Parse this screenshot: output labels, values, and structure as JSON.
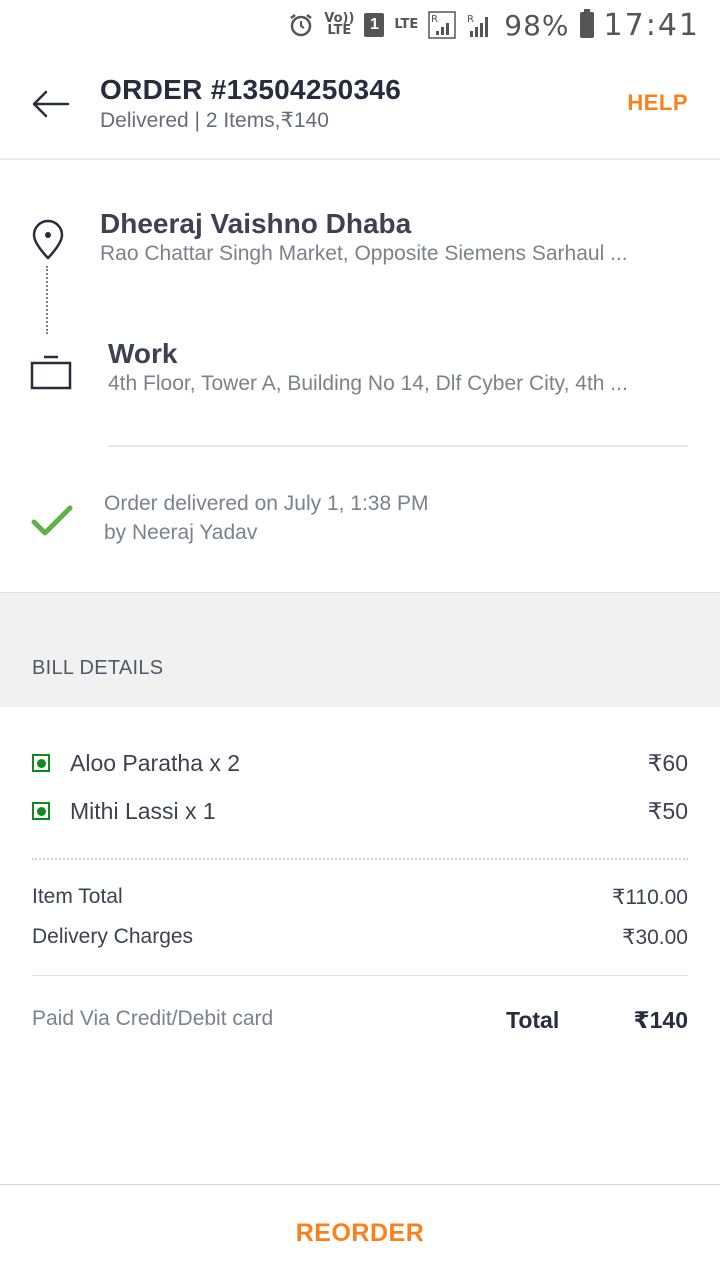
{
  "status_bar": {
    "volte_line1": "Vo))",
    "volte_line2": "LTE",
    "sim_slot": "1",
    "lte_label": "LTE",
    "roaming_1": "R",
    "roaming_2": "R",
    "battery_pct": "98%",
    "time": "17:41",
    "icons": [
      "alarm-icon",
      "signal-icon",
      "battery-icon"
    ]
  },
  "header": {
    "title": "ORDER #13504250346",
    "subtitle": "Delivered | 2 Items,₹140",
    "help_label": "HELP"
  },
  "restaurant": {
    "name": "Dheeraj Vaishno Dhaba",
    "address": "Rao Chattar Singh Market, Opposite Siemens Sarhaul ..."
  },
  "destination": {
    "title": "Work",
    "address": "4th Floor, Tower A, Building No 14, Dlf Cyber City, 4th ..."
  },
  "delivery": {
    "line1": "Order delivered on July 1, 1:38 PM",
    "line2": "by Neeraj Yadav"
  },
  "bill": {
    "title": "BILL DETAILS",
    "items": [
      {
        "name": "Aloo Paratha x 2",
        "price": "₹60"
      },
      {
        "name": "Mithi Lassi x 1",
        "price": "₹50"
      }
    ],
    "item_total_label": "Item Total",
    "item_total_value": "₹110.00",
    "delivery_label": "Delivery Charges",
    "delivery_value": "₹30.00",
    "paid_via": "Paid Via Credit/Debit card",
    "total_label": "Total",
    "total_value": "₹140"
  },
  "footer": {
    "reorder_label": "REORDER"
  },
  "colors": {
    "accent": "#fc8019",
    "veg_green": "#0f8a1e",
    "check_green": "#60b246"
  }
}
